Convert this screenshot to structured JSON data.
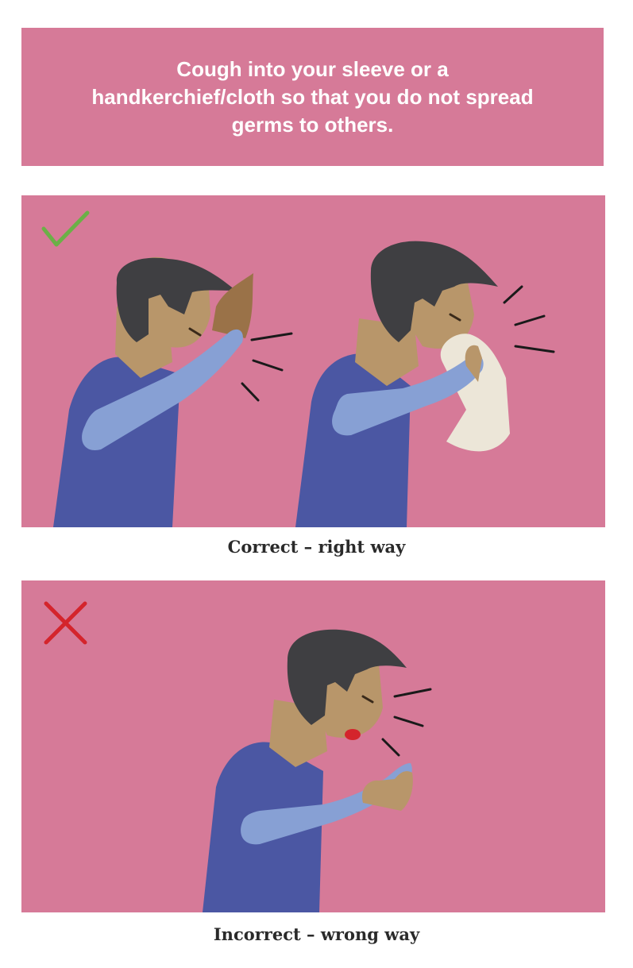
{
  "header": {
    "text": "Cough into your sleeve or a handkerchief/cloth so that you do not spread germs to others."
  },
  "panels": [
    {
      "caption": "Correct – right way",
      "status_icon": "check-icon",
      "status_color": "#6bb047"
    },
    {
      "caption": "Incorrect – wrong way",
      "status_icon": "cross-icon",
      "status_color": "#d4242c"
    }
  ],
  "colors": {
    "background_pink": "#d67a98",
    "hair": "#3f3f42",
    "skin": "#b8966a",
    "shirt": "#4b57a3",
    "sleeve": "#87a0d4",
    "cloth": "#ece6d8",
    "mouth": "#d4242c"
  }
}
